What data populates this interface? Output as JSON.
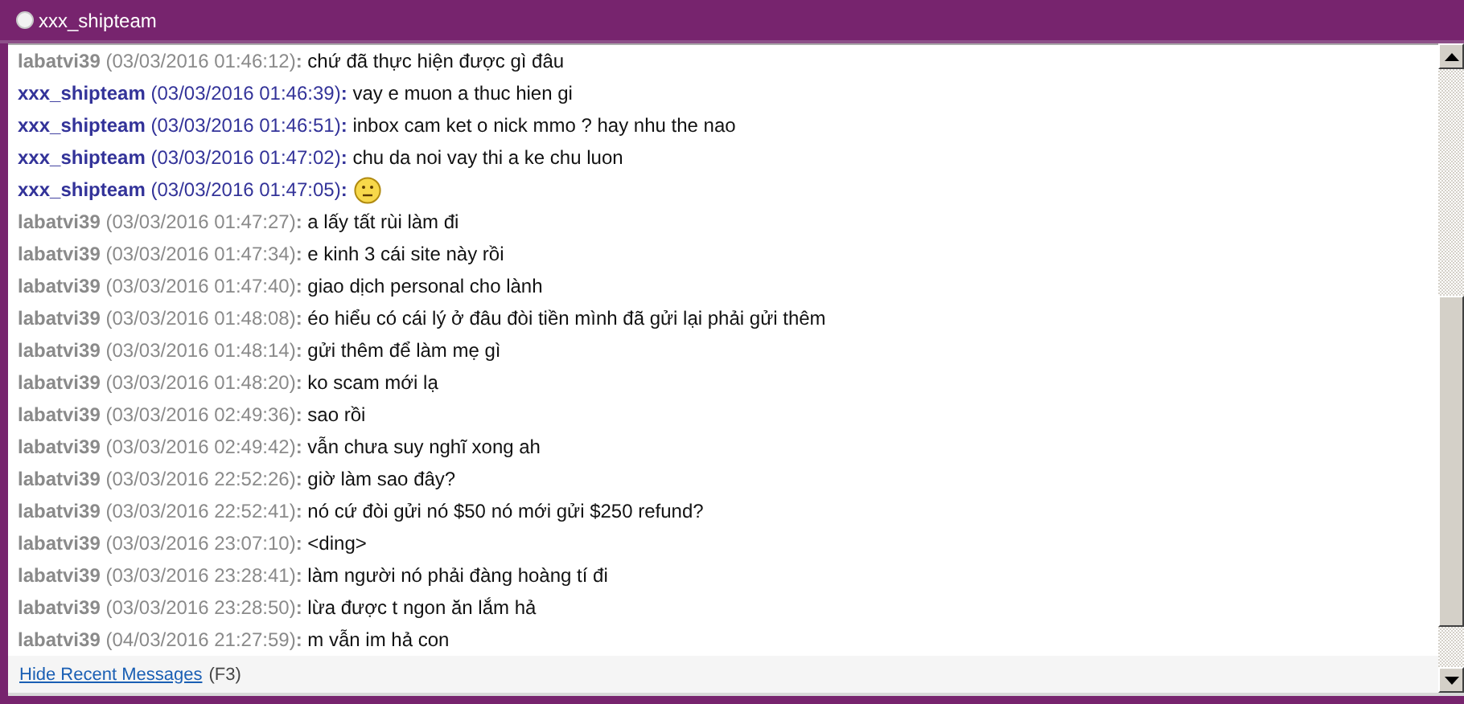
{
  "window": {
    "title": "xxx_shipteam"
  },
  "messages": [
    {
      "kind": "text",
      "outgoing": true,
      "sender": "labatvi39",
      "time": "(03/03/2016 01:46:12)",
      "separator": ":",
      "text": "chứ đã thực hiện được gì đâu"
    },
    {
      "kind": "text",
      "outgoing": false,
      "sender": "xxx_shipteam",
      "time": "(03/03/2016 01:46:39)",
      "separator": ":",
      "text": "vay e muon a thuc hien gi"
    },
    {
      "kind": "text",
      "outgoing": false,
      "sender": "xxx_shipteam",
      "time": "(03/03/2016 01:46:51)",
      "separator": ":",
      "text": "inbox cam ket o nick mmo ? hay nhu the nao"
    },
    {
      "kind": "text",
      "outgoing": false,
      "sender": "xxx_shipteam",
      "time": "(03/03/2016 01:47:02)",
      "separator": ":",
      "text": "chu da noi vay thi a ke chu luon"
    },
    {
      "kind": "emoticon",
      "outgoing": false,
      "sender": "xxx_shipteam",
      "time": "(03/03/2016 01:47:05)",
      "separator": ":"
    },
    {
      "kind": "text",
      "outgoing": true,
      "sender": "labatvi39",
      "time": "(03/03/2016 01:47:27)",
      "separator": ":",
      "text": "a lấy tất rùi làm đi"
    },
    {
      "kind": "text",
      "outgoing": true,
      "sender": "labatvi39",
      "time": "(03/03/2016 01:47:34)",
      "separator": ":",
      "text": "e kinh 3 cái site này rồi"
    },
    {
      "kind": "text",
      "outgoing": true,
      "sender": "labatvi39",
      "time": "(03/03/2016 01:47:40)",
      "separator": ":",
      "text": "giao dịch personal cho lành"
    },
    {
      "kind": "text",
      "outgoing": true,
      "sender": "labatvi39",
      "time": "(03/03/2016 01:48:08)",
      "separator": ":",
      "text": "éo hiểu có cái lý ở đâu đòi tiền mình đã gửi lại phải gửi thêm"
    },
    {
      "kind": "text",
      "outgoing": true,
      "sender": "labatvi39",
      "time": "(03/03/2016 01:48:14)",
      "separator": ":",
      "text": "gửi thêm để làm mẹ gì"
    },
    {
      "kind": "text",
      "outgoing": true,
      "sender": "labatvi39",
      "time": "(03/03/2016 01:48:20)",
      "separator": ":",
      "text": "ko scam mới lạ"
    },
    {
      "kind": "text",
      "outgoing": true,
      "sender": "labatvi39",
      "time": "(03/03/2016 02:49:36)",
      "separator": ":",
      "text": "sao rồi"
    },
    {
      "kind": "text",
      "outgoing": true,
      "sender": "labatvi39",
      "time": "(03/03/2016 02:49:42)",
      "separator": ":",
      "text": "vẫn chưa suy nghĩ xong ah"
    },
    {
      "kind": "text",
      "outgoing": true,
      "sender": "labatvi39",
      "time": "(03/03/2016 22:52:26)",
      "separator": ":",
      "text": "giờ làm sao đây?"
    },
    {
      "kind": "text",
      "outgoing": true,
      "sender": "labatvi39",
      "time": "(03/03/2016 22:52:41)",
      "separator": ":",
      "text": "nó cứ đòi gửi nó $50 nó mới gửi $250 refund?"
    },
    {
      "kind": "text",
      "outgoing": true,
      "sender": "labatvi39",
      "time": "(03/03/2016 23:07:10)",
      "separator": ":",
      "text": "<ding>"
    },
    {
      "kind": "text",
      "outgoing": true,
      "sender": "labatvi39",
      "time": "(03/03/2016 23:28:41)",
      "separator": ":",
      "text": "làm người nó phải đàng hoàng tí đi"
    },
    {
      "kind": "text",
      "outgoing": true,
      "sender": "labatvi39",
      "time": "(03/03/2016 23:28:50)",
      "separator": ":",
      "text": "lừa được t ngon ăn lắm hả"
    },
    {
      "kind": "text",
      "outgoing": true,
      "sender": "labatvi39",
      "time": "(04/03/2016 21:27:59)",
      "separator": ":",
      "text": "m vẫn im hả con"
    }
  ],
  "footer": {
    "link": "Hide Recent Messages",
    "shortcut": "(F3)"
  }
}
